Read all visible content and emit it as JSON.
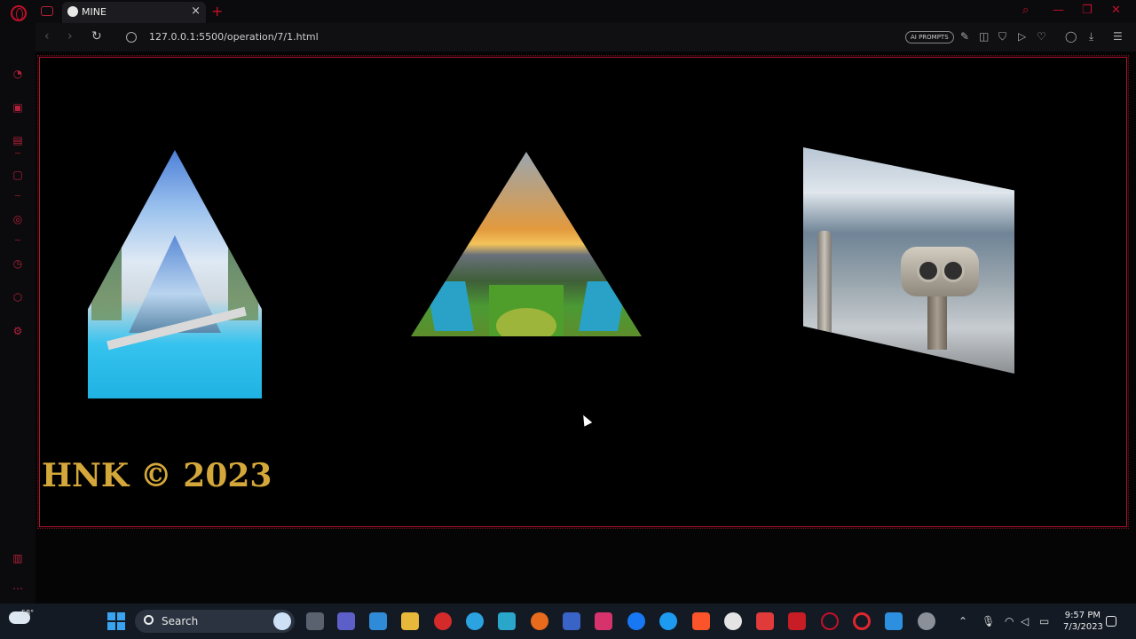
{
  "browser": {
    "tab_title": "MINE",
    "tab_close": "×",
    "new_tab": "+",
    "url": "127.0.0.1:5500/operation/7/1.html",
    "ai_prompts_label": "AI PROMPTS",
    "accent_color": "#c3102a"
  },
  "page": {
    "footer_text": "HNK © 2023",
    "footer_color": "#d4a73a",
    "border_color": "#b3122b",
    "shapes": [
      "pentagon-house-image",
      "triangle-image",
      "skewed-panel-image"
    ]
  },
  "taskbar": {
    "weather_temp": "58°",
    "search_label": "Search",
    "clock_time": "9:57 PM",
    "clock_date": "7/3/2023"
  }
}
